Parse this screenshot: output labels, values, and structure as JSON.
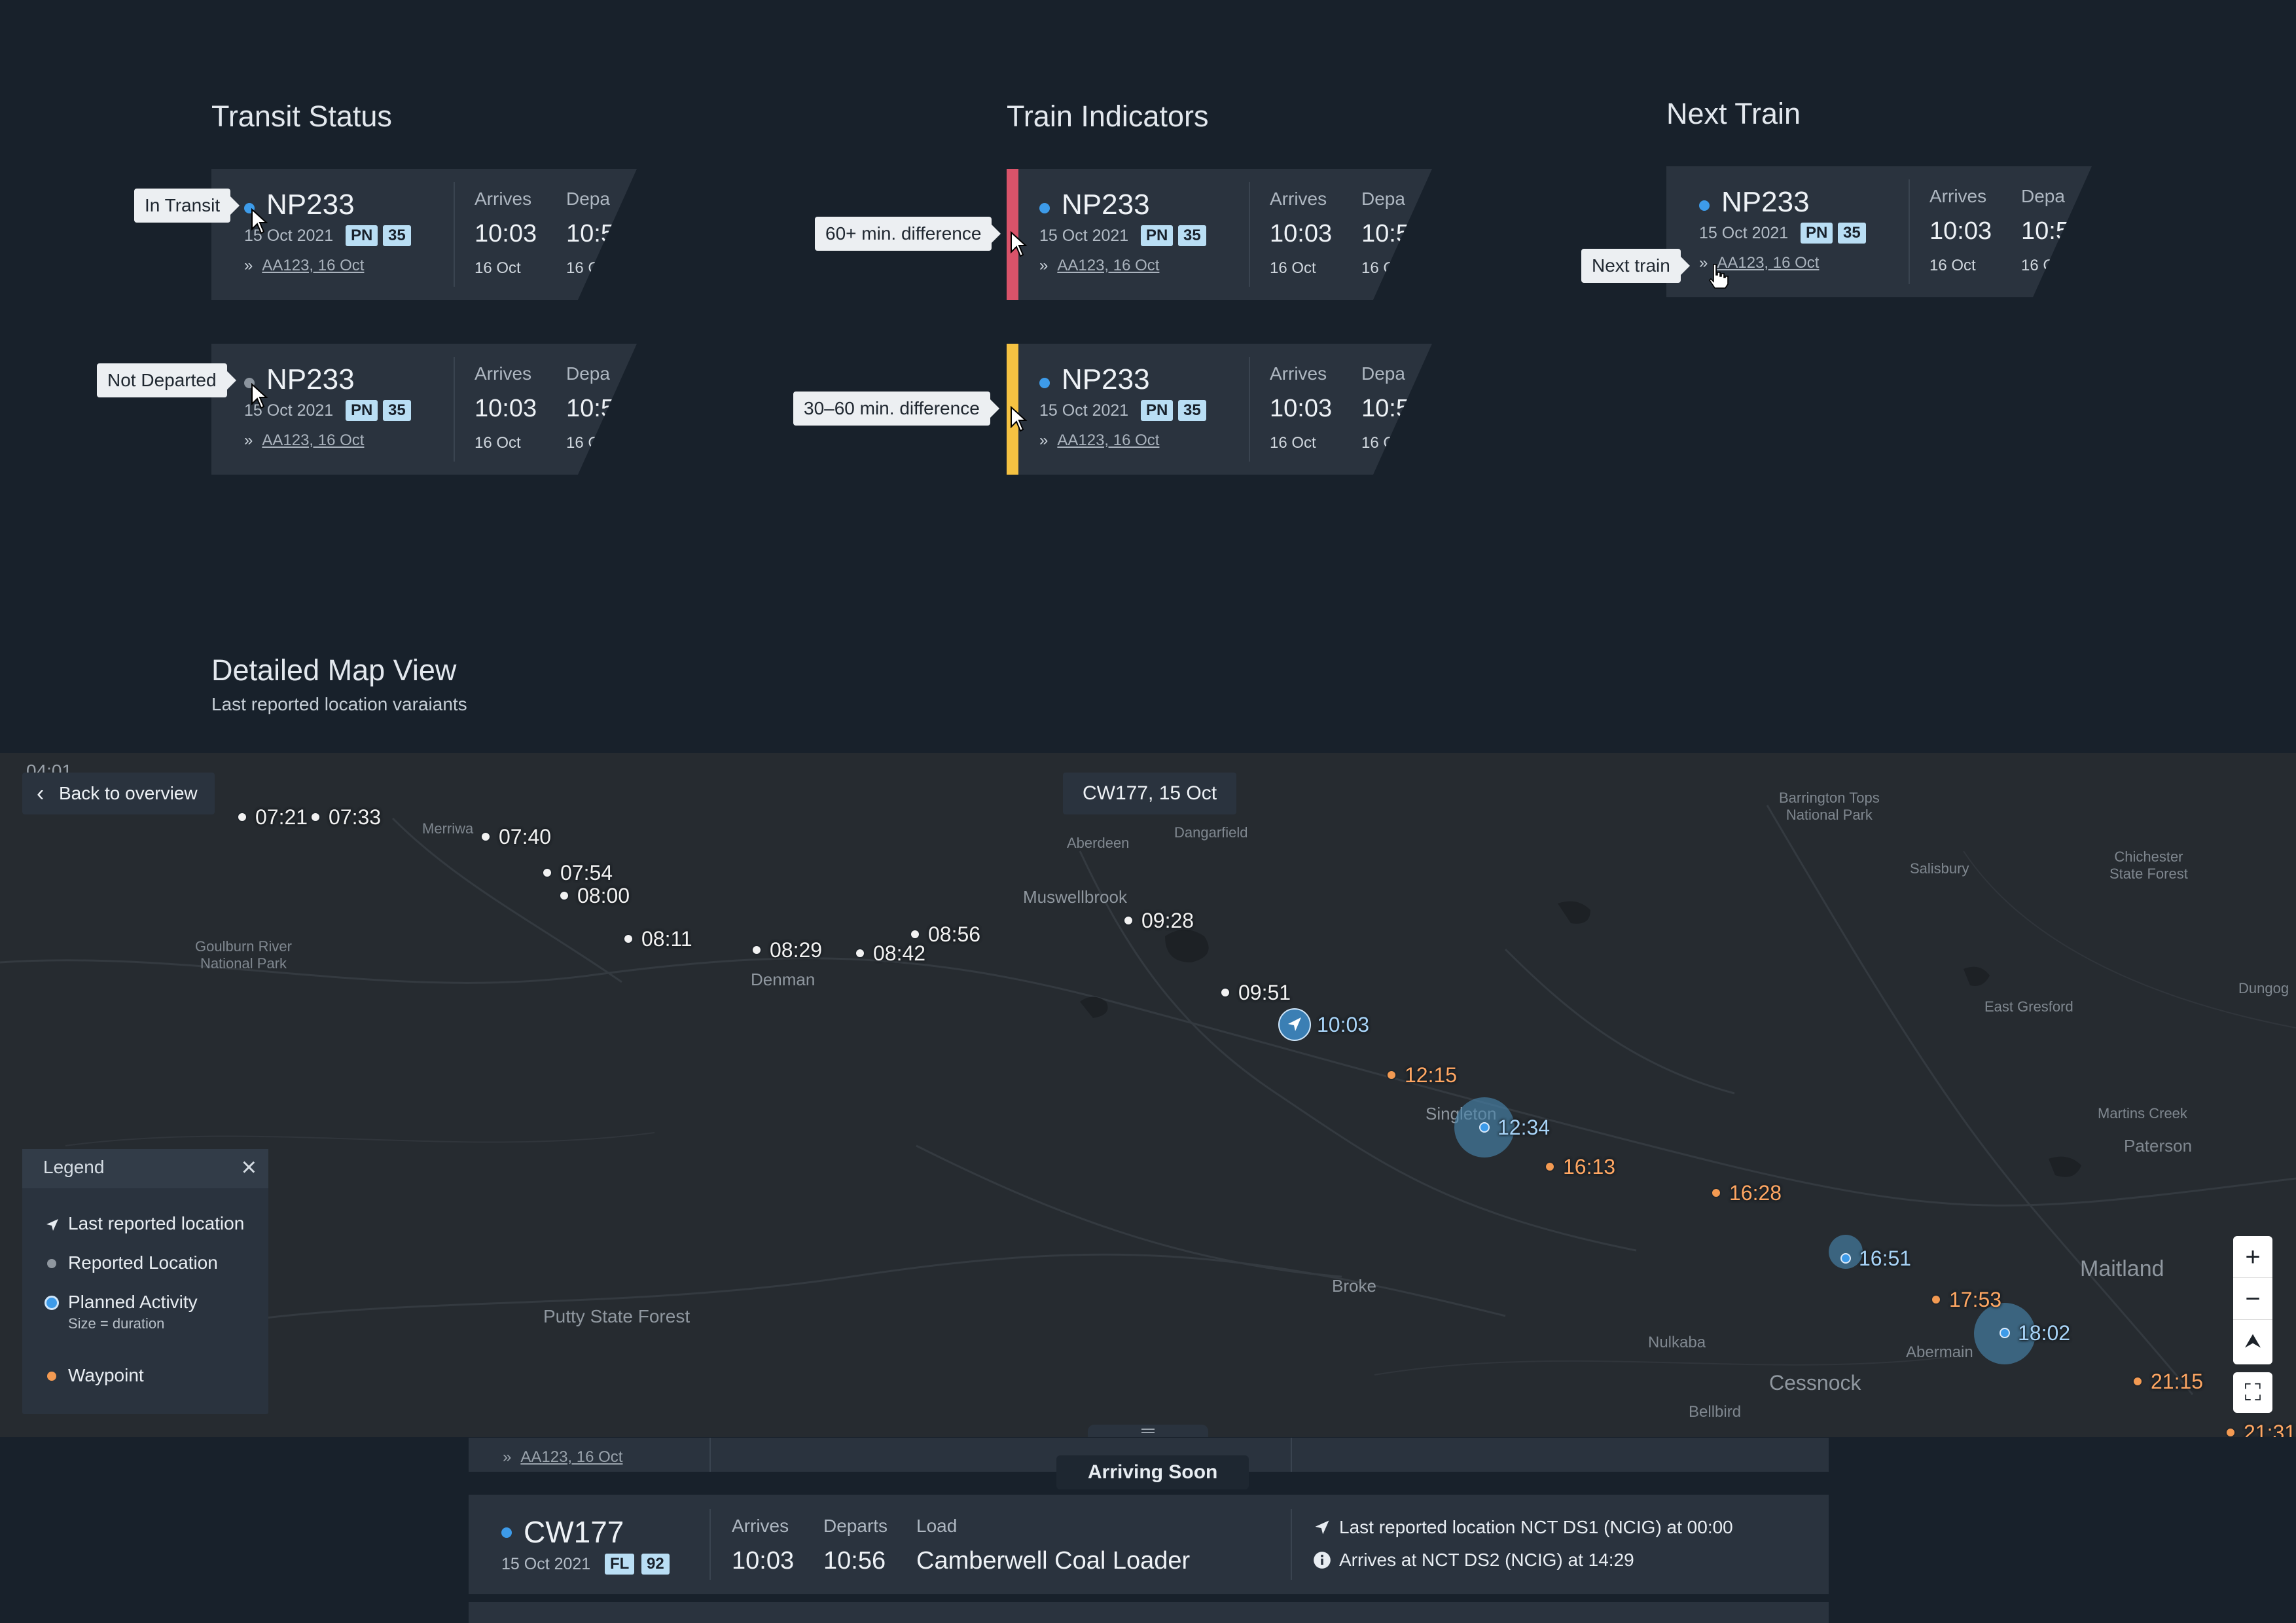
{
  "sections": {
    "transit": {
      "title": "Transit Status"
    },
    "indicators": {
      "title": "Train Indicators"
    },
    "next": {
      "title": "Next Train"
    },
    "map": {
      "title": "Detailed Map View",
      "subtitle": "Last reported location varaiants"
    }
  },
  "card": {
    "code": "NP233",
    "date": "15 Oct 2021",
    "badge1": "PN",
    "badge2": "35",
    "link": "AA123, 16 Oct",
    "arrives_label": "Arrives",
    "arrives_time": "10:03",
    "arrives_date": "16 Oct",
    "departs_label": "Depa",
    "departs_time": "10:5",
    "departs_date": "16 C"
  },
  "tooltips": {
    "in_transit": "In Transit",
    "not_departed": "Not Departed",
    "diff_60": "60+ min. difference",
    "diff_30": "30–60 min. difference",
    "next_train": "Next train"
  },
  "colors": {
    "diff_60": "#d9536a",
    "diff_30": "#f5c242",
    "accent": "#3d9be9",
    "waypoint": "#f39a52"
  },
  "map": {
    "back_label": "Back to overview",
    "popup": "CW177, 15 Oct",
    "clip_label": "04:01",
    "places": {
      "goulburn": "Goulburn River\nNational Park",
      "merriwa": "Merriwa",
      "aberdeen": "Aberdeen",
      "dangarfield": "Dangarfield",
      "muswellbrook": "Muswellbrook",
      "denman": "Denman",
      "barrington": "Barrington Tops\nNational Park",
      "salisbury": "Salisbury",
      "chichester": "Chichester\nState Forest",
      "dungog": "Dungog",
      "east_gresford": "East Gresford",
      "martins_creek": "Martins Creek",
      "paterson": "Paterson",
      "singleton": "Singleton",
      "broke": "Broke",
      "putty": "Putty State Forest",
      "maitland": "Maitland",
      "nulkaba": "Nulkaba",
      "abermain": "Abermain",
      "cessnock": "Cessnock",
      "bellbird": "Bellbird"
    },
    "points": [
      {
        "time": "07:21",
        "kind": "reported"
      },
      {
        "time": "07:33",
        "kind": "reported"
      },
      {
        "time": "07:40",
        "kind": "reported"
      },
      {
        "time": "07:54",
        "kind": "reported"
      },
      {
        "time": "08:00",
        "kind": "reported"
      },
      {
        "time": "08:11",
        "kind": "reported"
      },
      {
        "time": "08:29",
        "kind": "reported"
      },
      {
        "time": "08:42",
        "kind": "reported"
      },
      {
        "time": "08:56",
        "kind": "reported"
      },
      {
        "time": "09:28",
        "kind": "reported"
      },
      {
        "time": "09:51",
        "kind": "reported"
      },
      {
        "time": "10:03",
        "kind": "last-reported"
      },
      {
        "time": "12:15",
        "kind": "waypoint"
      },
      {
        "time": "12:34",
        "kind": "planned"
      },
      {
        "time": "16:13",
        "kind": "waypoint"
      },
      {
        "time": "16:28",
        "kind": "waypoint"
      },
      {
        "time": "16:51",
        "kind": "planned"
      },
      {
        "time": "17:53",
        "kind": "waypoint"
      },
      {
        "time": "18:02",
        "kind": "planned"
      },
      {
        "time": "21:15",
        "kind": "waypoint"
      },
      {
        "time": "21:31",
        "kind": "waypoint"
      }
    ],
    "legend": {
      "title": "Legend",
      "items": {
        "last": "Last reported location",
        "reported": "Reported Location",
        "planned": "Planned Activity",
        "planned_sub": "Size = duration",
        "waypoint": "Waypoint"
      }
    },
    "zoom": {
      "in": "+",
      "out": "−",
      "compass": "⮝",
      "fullscreen": "⛶"
    }
  },
  "bottom": {
    "peek_link": "AA123, 16 Oct",
    "arriving_soon": "Arriving Soon",
    "code": "CW177",
    "date": "15 Oct 2021",
    "badge1": "FL",
    "badge2": "92",
    "arrives_label": "Arrives",
    "arrives_time": "10:03",
    "departs_label": "Departs",
    "departs_time": "10:56",
    "load_label": "Load",
    "load_value": "Camberwell Coal Loader",
    "info1": "Last reported location NCT DS1 (NCIG) at 00:00",
    "info2": "Arrives at NCT DS2 (NCIG) at 14:29"
  }
}
